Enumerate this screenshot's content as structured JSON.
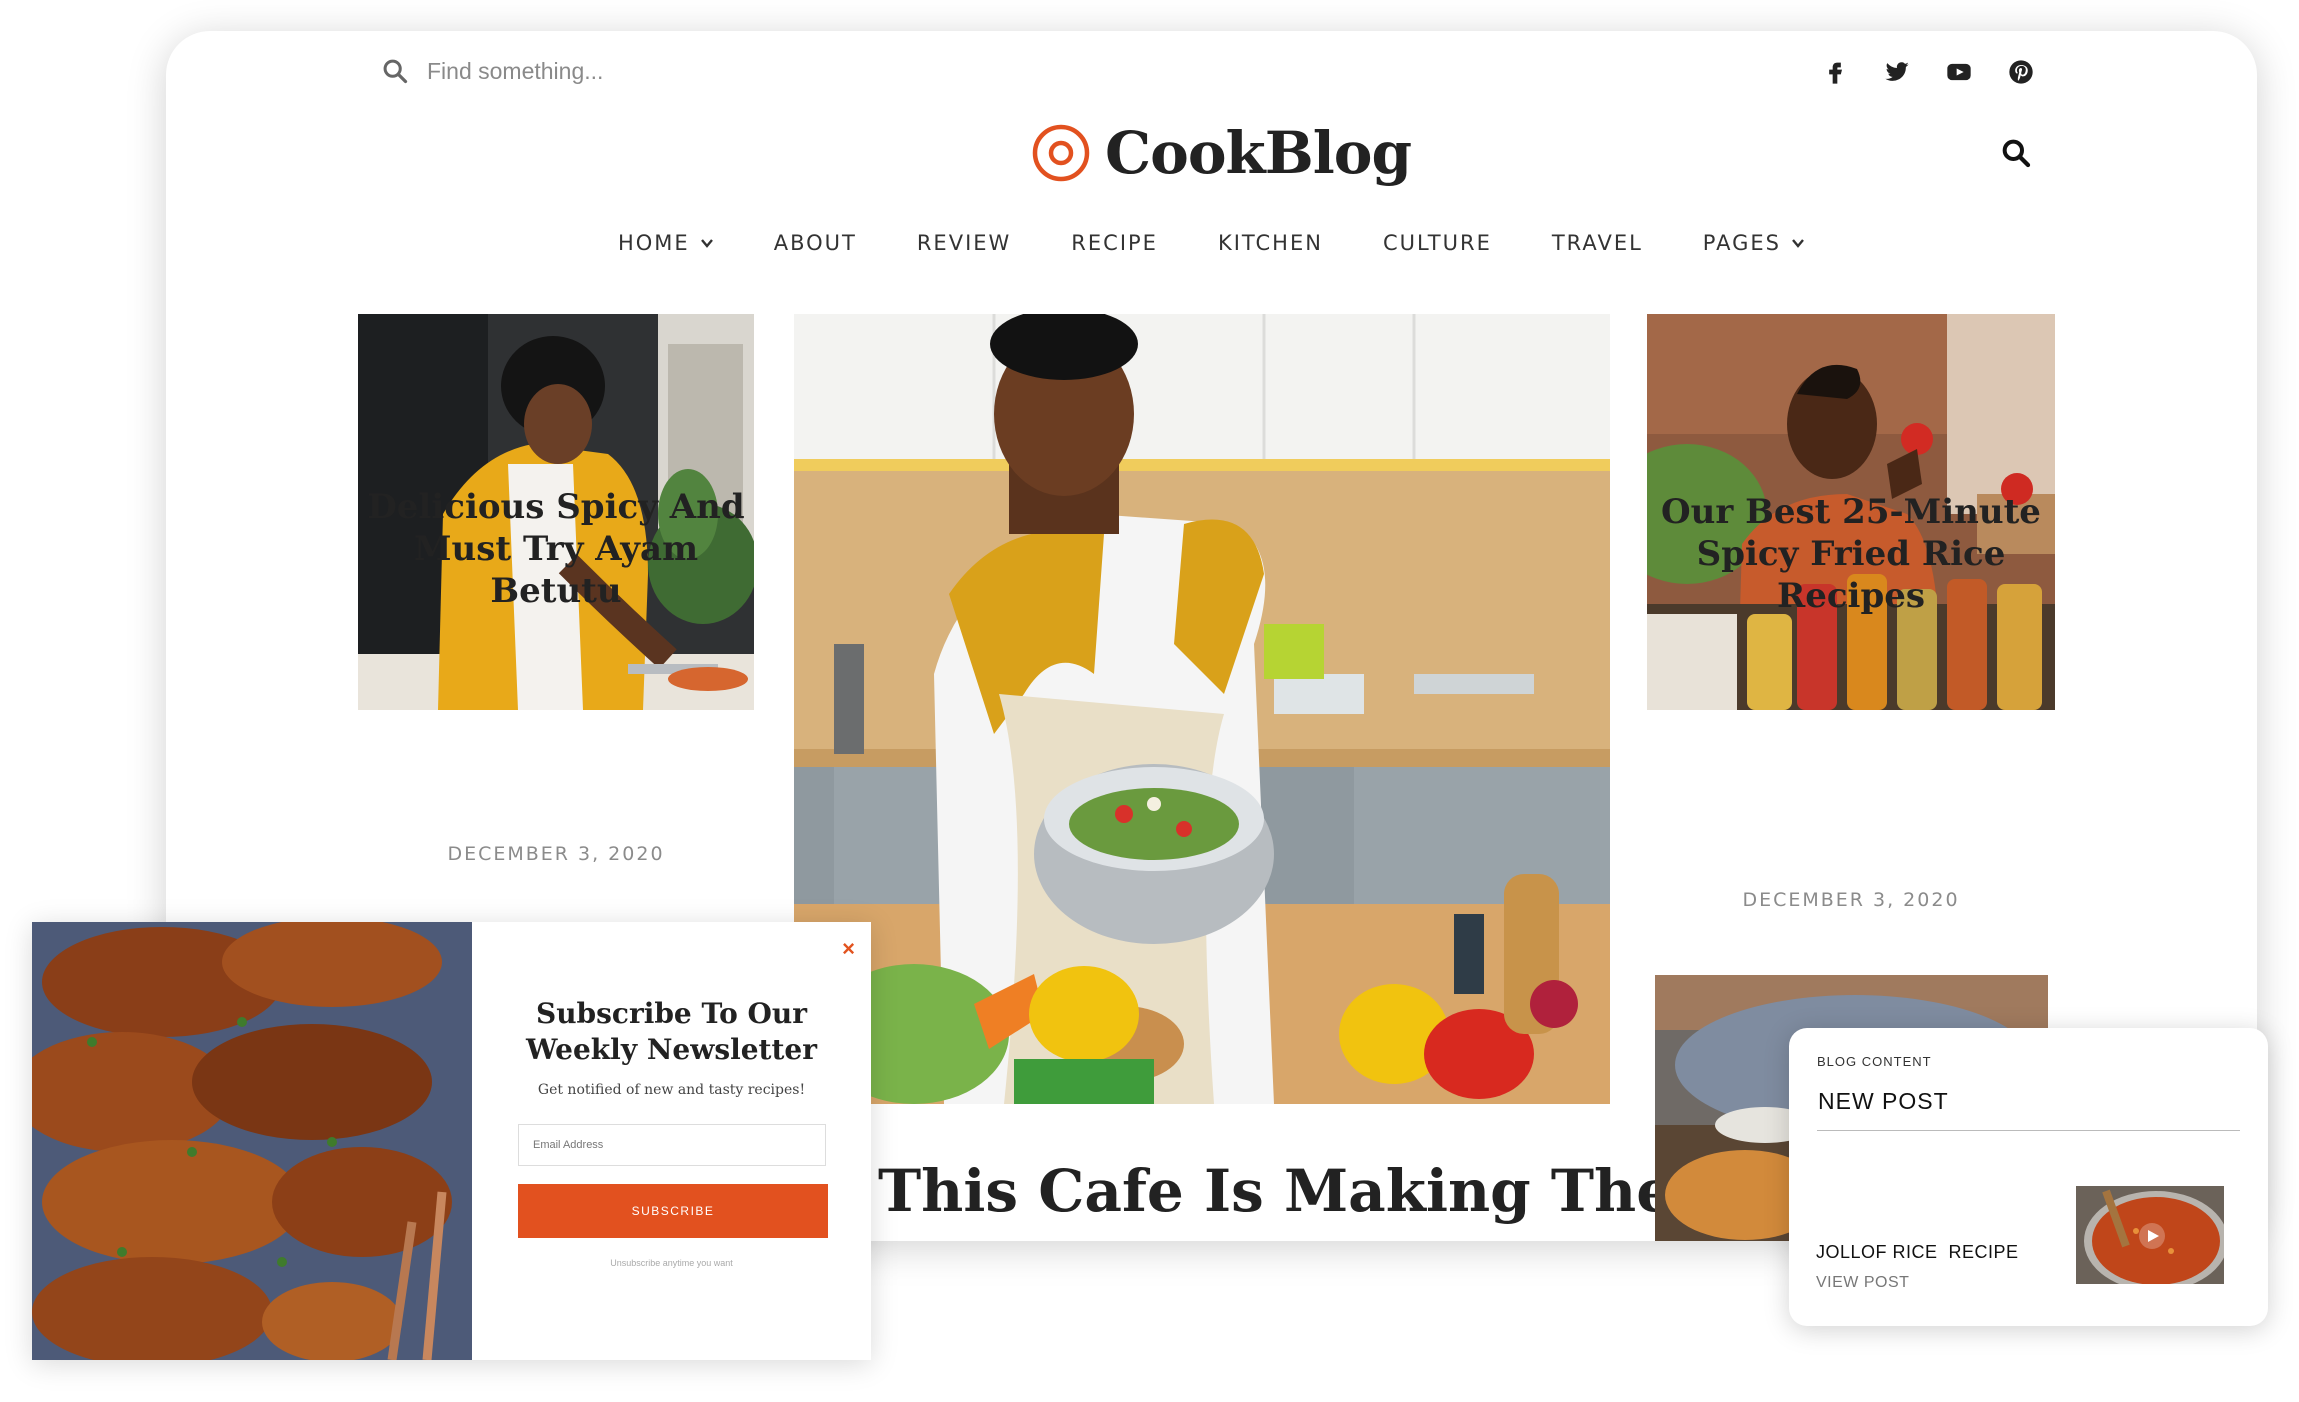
{
  "site": {
    "search_placeholder": "Find something...",
    "logo_text": "CookBlog",
    "brand_color": "#e2511f"
  },
  "socials": [
    "facebook-icon",
    "twitter-icon",
    "youtube-icon",
    "pinterest-icon"
  ],
  "nav": {
    "items": [
      {
        "label": "HOME",
        "has_dropdown": true
      },
      {
        "label": "ABOUT",
        "has_dropdown": false
      },
      {
        "label": "REVIEW",
        "has_dropdown": false
      },
      {
        "label": "RECIPE",
        "has_dropdown": false
      },
      {
        "label": "KITCHEN",
        "has_dropdown": false
      },
      {
        "label": "CULTURE",
        "has_dropdown": false
      },
      {
        "label": "TRAVEL",
        "has_dropdown": false
      },
      {
        "label": "PAGES",
        "has_dropdown": true
      }
    ]
  },
  "posts": {
    "left": {
      "title_line1": "Delicious Spicy And",
      "title_line2": "Must Try Ayam Betutu",
      "date": "DECEMBER 3, 2020"
    },
    "center": {
      "title": "This Cafe Is Making The"
    },
    "right": {
      "title_line1": "Our Best 25-Minute",
      "title_line2": "Spicy Fried Rice",
      "title_line3": "Recipes",
      "date": "DECEMBER 3, 2020"
    }
  },
  "newsletter": {
    "close": "×",
    "title_line1": "Subscribe To Our",
    "title_line2": "Weekly Newsletter",
    "subtitle": "Get notified of new and tasty recipes!",
    "email_placeholder": "Email Address",
    "button": "SUBSCRIBE",
    "footer": "Unsubscribe anytime you want"
  },
  "widget": {
    "label": "BLOG CONTENT",
    "title": "NEW POST",
    "post_title": "JOLLOF RICE  RECIPE",
    "view": "VIEW POST"
  }
}
